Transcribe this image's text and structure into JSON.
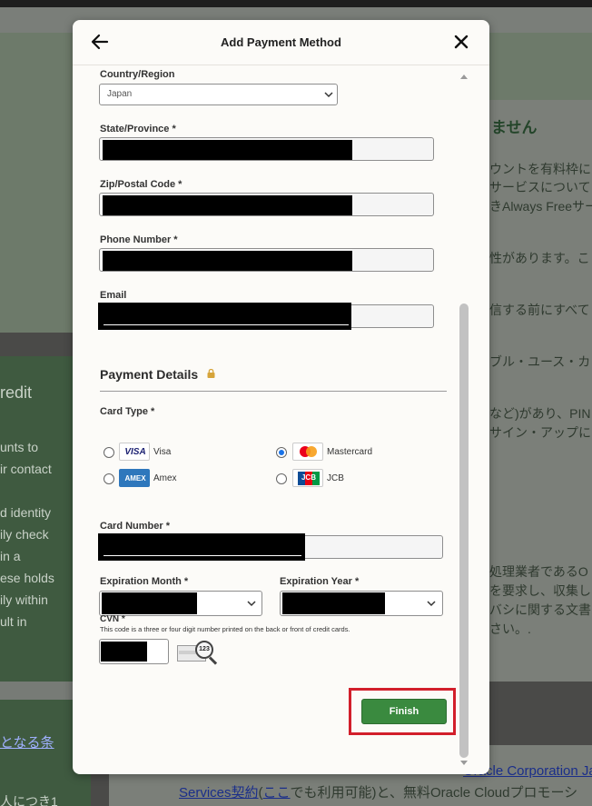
{
  "background": {
    "right_heading": "ません",
    "right_lines": [
      "ウントを有料枠に",
      "サービスについて",
      "きAlways Freeサー",
      "性があります。こ",
      "信する前にすべて",
      "ブル・ユース・カ",
      "など)があり、PIN",
      "サイン・アップに",
      "処理業者であるO",
      "を要求し、収集し",
      "バシに関する文書",
      "さい。."
    ],
    "left_heading": "redit",
    "left_lines": [
      "unts to",
      "ir contact",
      "d identity",
      "ily check",
      "in a",
      "ese holds",
      "ily within",
      "ult in"
    ],
    "left_link": "となる条",
    "left_bottom": "人につき1",
    "bottom_link_1": "Oracle Corporation Ja",
    "bottom_line_2_link": "Services契約",
    "bottom_line_2_paren": "(",
    "bottom_line_2_here": "ここ",
    "bottom_line_2_rest": "でも利用可能)と、無料Oracle Cloudプロモーシ"
  },
  "modal": {
    "title": "Add Payment Method",
    "country_label": "Country/Region",
    "country_value": "Japan",
    "state_label": "State/Province *",
    "zip_label": "Zip/Postal Code *",
    "phone_label": "Phone Number *",
    "email_label": "Email",
    "payment_title": "Payment Details",
    "card_type_label": "Card Type *",
    "cards": {
      "visa": "Visa",
      "mastercard": "Mastercard",
      "amex": "Amex",
      "jcb": "JCB"
    },
    "card_logos": {
      "visa": "VISA",
      "amex": "AMEX",
      "jcb": "JCB"
    },
    "card_number_label": "Card Number *",
    "exp_month_label": "Expiration Month *",
    "exp_year_label": "Expiration Year *",
    "cvn_label": "CVN *",
    "cvn_hint": "This code is a three or four digit number printed on the back or front of credit cards.",
    "cvn_icon_text": "123",
    "finish_label": "Finish"
  },
  "colors": {
    "finish": "#3a8a3f",
    "highlight": "#d21f2b",
    "radio_checked": "#1a73e8"
  }
}
